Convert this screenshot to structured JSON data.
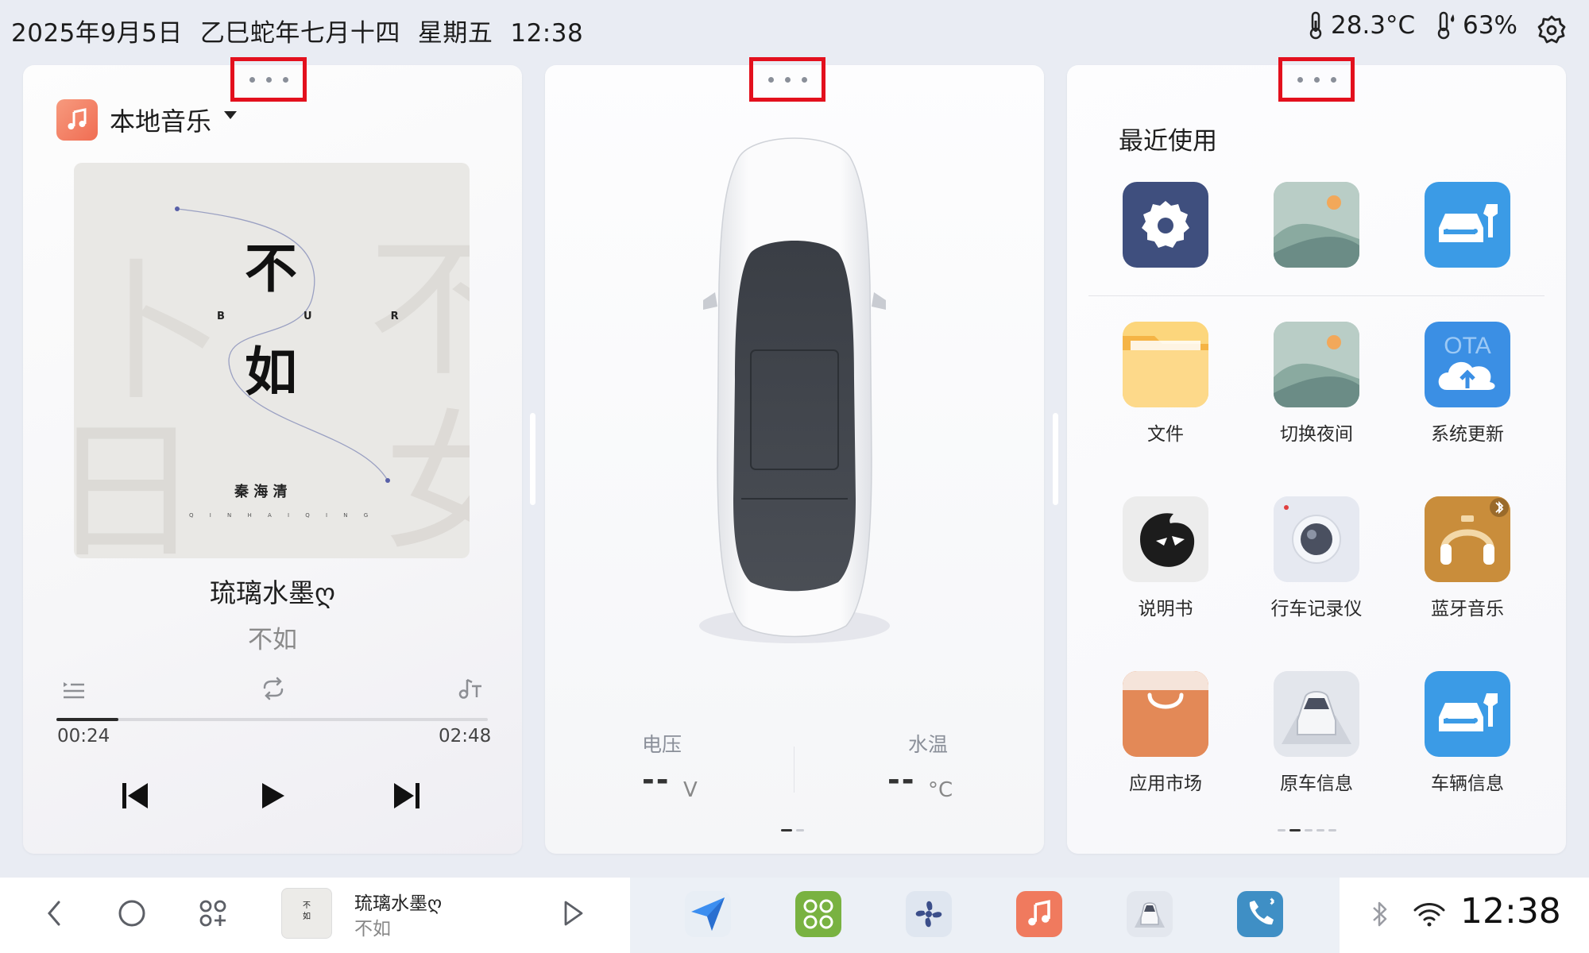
{
  "status_bar": {
    "date": "2025年9月5日",
    "lunar_date": "乙巳蛇年七月十四",
    "weekday": "星期五",
    "time": "12:38",
    "temperature": "28.3°C",
    "humidity": "63%"
  },
  "music_card": {
    "source": "本地音乐",
    "album_art_text": {
      "char1": "不",
      "char2": "如",
      "pinyin": "B  U  R  U",
      "artist": "秦 海 清",
      "artist_pinyin": "Q I N H A I Q I N G"
    },
    "song_title": "琉璃水墨ღ",
    "artist": "不如",
    "elapsed": "00:24",
    "total": "02:48",
    "progress": 0.1429
  },
  "vehicle_card": {
    "voltage_label": "电压",
    "voltage_value": "--",
    "voltage_unit": "V",
    "water_temp_label": "水温",
    "water_temp_value": "--",
    "water_temp_unit": "°C"
  },
  "apps_card": {
    "heading": "最近使用",
    "recent": [
      {
        "icon": "settings-icon",
        "color": "#3f4f7e"
      },
      {
        "icon": "landscape-icon",
        "color": "#9bb6ad"
      },
      {
        "icon": "car-service-icon",
        "color": "#3b9be6"
      }
    ],
    "apps": [
      {
        "label": "文件",
        "icon": "folder-icon",
        "color": "#fbcf6a"
      },
      {
        "label": "切换夜间",
        "icon": "landscape-icon",
        "color": "#9bb6ad"
      },
      {
        "label": "系统更新",
        "icon": "ota-cloud-icon",
        "color": "#3b8fe4"
      },
      {
        "label": "说明书",
        "icon": "manual-icon",
        "color": "#ececec"
      },
      {
        "label": "行车记录仪",
        "icon": "dashcam-icon",
        "color": "#e9ecf3"
      },
      {
        "label": "蓝牙音乐",
        "icon": "headphones-icon",
        "color": "#c98d3b"
      },
      {
        "label": "应用市场",
        "icon": "shopping-bag-icon",
        "color": "#e08a5a"
      },
      {
        "label": "原车信息",
        "icon": "car-info-icon",
        "color": "#e2e4ea"
      },
      {
        "label": "车辆信息",
        "icon": "car-service-icon",
        "color": "#3b9be6"
      }
    ]
  },
  "taskbar": {
    "song_title": "琉璃水墨ღ",
    "artist": "不如",
    "clock": "12:38",
    "dock": [
      {
        "icon": "navigation-icon",
        "color": "#e8eef5"
      },
      {
        "icon": "apps-grid-icon",
        "color": "#79b241"
      },
      {
        "icon": "fan-icon",
        "color": "#dfe6f0"
      },
      {
        "icon": "music-icon",
        "color": "#f07a5e"
      },
      {
        "icon": "car-icon",
        "color": "#e3e7ee"
      },
      {
        "icon": "phone-icon",
        "color": "#3f8fc5"
      }
    ]
  }
}
